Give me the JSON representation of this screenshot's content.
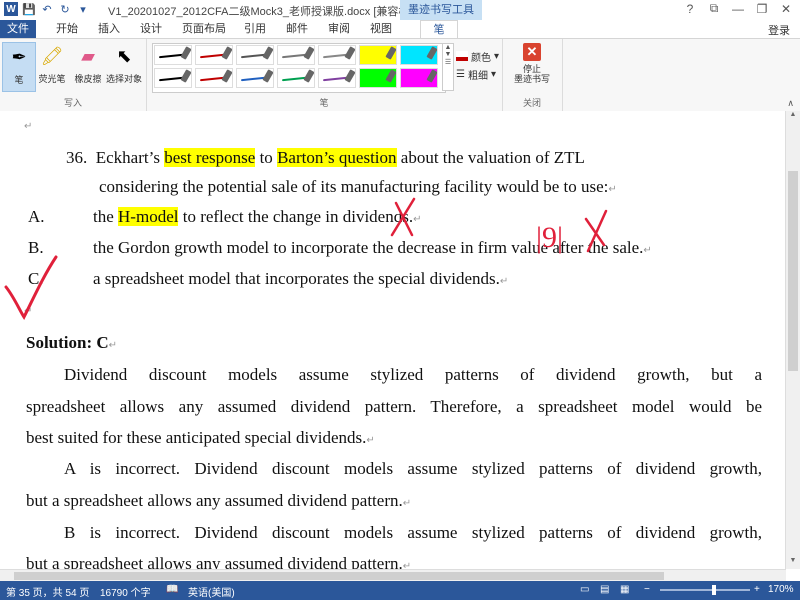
{
  "window": {
    "title": "V1_20201027_2012CFA二级Mock3_老师授课版.docx [兼容模...",
    "context_tab": "墨迹书写工具",
    "login": "登录",
    "controls": [
      "?",
      "⧉",
      "—",
      "❐",
      "✕"
    ]
  },
  "tabs": [
    {
      "label": "文件"
    },
    {
      "label": "开始"
    },
    {
      "label": "插入"
    },
    {
      "label": "设计"
    },
    {
      "label": "页面布局"
    },
    {
      "label": "引用"
    },
    {
      "label": "邮件"
    },
    {
      "label": "审阅"
    },
    {
      "label": "视图"
    },
    {
      "label": "笔"
    }
  ],
  "ribbon": {
    "write_group": {
      "name": "写入",
      "tools": [
        {
          "label": "笔",
          "icon": "pen-icon"
        },
        {
          "label": "荧光笔",
          "icon": "highlighter-icon"
        },
        {
          "label": "橡皮擦",
          "icon": "eraser-icon"
        },
        {
          "label": "选择对象",
          "icon": "select-object-icon"
        }
      ]
    },
    "pen_group": {
      "name": "笔",
      "color_label": "颜色",
      "thickness_label": "粗细",
      "swatches": [
        {
          "color": "#000000",
          "type": "pen"
        },
        {
          "color": "#c00000",
          "type": "pen"
        },
        {
          "color": "#555555",
          "type": "pen"
        },
        {
          "color": "#777777",
          "type": "pen"
        },
        {
          "color": "#888888",
          "type": "pen"
        },
        {
          "color": "#ffff00",
          "type": "highlighter"
        },
        {
          "color": "#00e5ff",
          "type": "highlighter"
        },
        {
          "color": "#000000",
          "type": "pen"
        },
        {
          "color": "#c00000",
          "type": "pen"
        },
        {
          "color": "#2060c0",
          "type": "pen"
        },
        {
          "color": "#00a050",
          "type": "pen"
        },
        {
          "color": "#8040a0",
          "type": "pen"
        },
        {
          "color": "#00ff00",
          "type": "highlighter"
        },
        {
          "color": "#ff00ff",
          "type": "highlighter"
        }
      ]
    },
    "close_group": {
      "name": "关闭",
      "stop_label_line1": "停止",
      "stop_label_line2": "墨迹书写"
    }
  },
  "document": {
    "para_mark": "↵",
    "question": {
      "number": "36.",
      "part1": "Eckhart’s ",
      "hl1": "best response",
      "part2": " to ",
      "hl2": "Barton’s question",
      "part3": " about the valuation of ZTL",
      "line2": "considering the potential sale of its manufacturing facility would be to use:"
    },
    "options": [
      {
        "letter": "A.",
        "pre": "the ",
        "hl": "H-model",
        "post": " to reflect the change in dividends."
      },
      {
        "letter": "B.",
        "pre": "",
        "hl": "",
        "post": "the Gordon growth model to incorporate the decrease in firm value after the sale."
      },
      {
        "letter": "C.",
        "pre": "",
        "hl": "",
        "post": "a spreadsheet model that incorporates the special dividends."
      }
    ],
    "solution_label": "Solution: C",
    "paragraphs": [
      {
        "lines": [
          "Dividend discount models assume stylized patterns of dividend growth, but a",
          "spreadsheet allows any assumed dividend pattern. Therefore, a spreadsheet model would be",
          "best suited for these anticipated special dividends."
        ]
      },
      {
        "lines": [
          "A is incorrect. Dividend discount models assume stylized patterns of dividend growth,",
          "but a spreadsheet allows any assumed dividend pattern."
        ]
      },
      {
        "lines": [
          "B is incorrect. Dividend discount models assume stylized patterns of dividend growth,",
          "but a spreadsheet allows any assumed dividend pattern."
        ]
      }
    ],
    "ink_annotation_text": "|9|"
  },
  "status": {
    "page": "第 35 页，共 54 页",
    "words": "16790 个字",
    "language": "英语(美国)",
    "zoom": "170%"
  }
}
